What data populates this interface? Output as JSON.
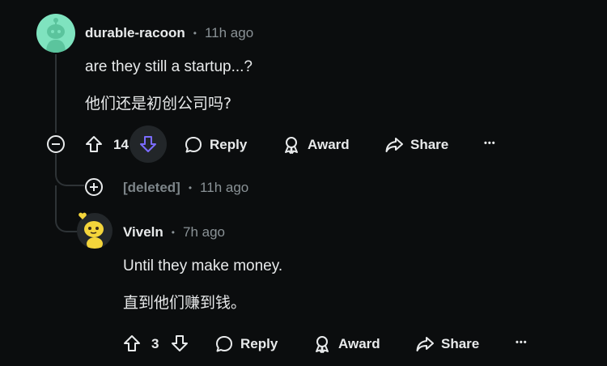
{
  "comment1": {
    "username": "durable-racoon",
    "separator": "•",
    "time": "11h ago",
    "text_en": "are they still a startup...?",
    "text_zh": "他们还是初创公司吗?",
    "score": "14",
    "reply_label": "Reply",
    "award_label": "Award",
    "share_label": "Share",
    "more_label": "•••",
    "downvote_active": true
  },
  "deleted_comment": {
    "username": "[deleted]",
    "separator": "•",
    "time": "11h ago"
  },
  "comment2": {
    "username": "Viveln",
    "separator": "•",
    "time": "7h ago",
    "text_en": "Until they make money.",
    "text_zh": "直到他们赚到钱。",
    "score": "3",
    "reply_label": "Reply",
    "award_label": "Award",
    "share_label": "Share",
    "more_label": "•••"
  },
  "colors": {
    "background": "#0b0d0e",
    "text": "#e8eaeb",
    "muted": "#8a9296",
    "avatar1": "#7fe3bf",
    "downvote_accent": "#7b6cff"
  }
}
